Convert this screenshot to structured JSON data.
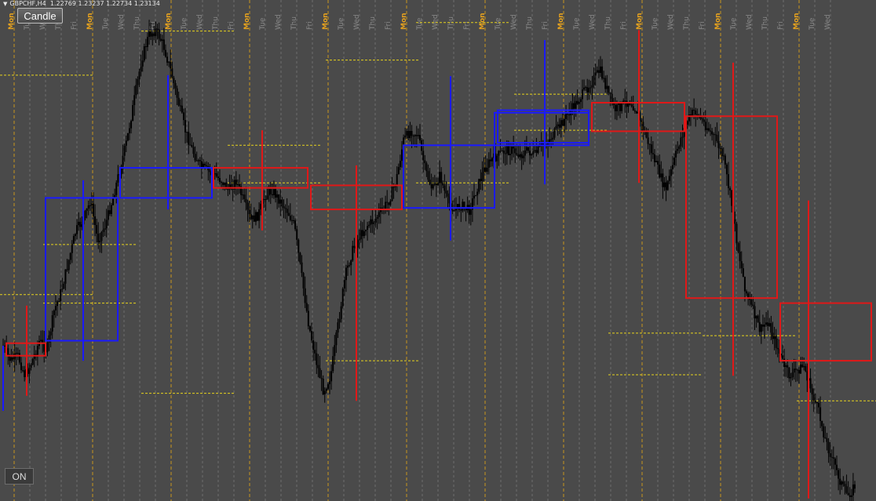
{
  "chart_header": {
    "symbol": "GBPCHF,H4",
    "ohlc": "1.22769 1.23237 1.22734 1.23134"
  },
  "buttons": {
    "mode_label": "Candle",
    "toggle_label": "ON"
  },
  "colors": {
    "background": "#4a4a4a",
    "candle": "#000000",
    "grid_weekday": "#6e6e6e",
    "grid_week": "#c8961e",
    "label_weekday": "#8a8a8a",
    "label_week": "#e6a21e",
    "bull_box": "#1a1aff",
    "bear_box": "#e01818",
    "level_line": "#e6d21e"
  },
  "chart_data": {
    "type": "candlestick",
    "symbol": "GBPCHF",
    "timeframe": "H4",
    "last_ohlc": {
      "open": 1.22769,
      "high": 1.23237,
      "low": 1.22734,
      "close": 1.23134
    },
    "x_day_labels": [
      "Mon",
      "Tue",
      "Wed",
      "Thu",
      "Fri",
      "Mon",
      "Tue",
      "Wed",
      "Thu",
      "Fri",
      "Mon",
      "Tue",
      "Wed",
      "Thu",
      "Fri",
      "Mon",
      "Tue",
      "Wed",
      "Thu",
      "Fri",
      "Mon",
      "Tue",
      "Wed",
      "Thu",
      "Fri",
      "Mon",
      "Tue",
      "Wed",
      "Thu",
      "Fri",
      "Mon",
      "Tue",
      "Wed",
      "Thu",
      "Fri",
      "Mon",
      "Tue",
      "Wed",
      "Thu",
      "Fri",
      "Mon",
      "Tue",
      "Wed",
      "Thu",
      "Fri",
      "Mon",
      "Tue",
      "Wed",
      "Thu",
      "Fri",
      "Mon",
      "Tue",
      "Wed"
    ],
    "price_path": [
      0.69,
      0.72,
      0.71,
      0.75,
      0.72,
      0.68,
      0.7,
      0.62,
      0.58,
      0.52,
      0.46,
      0.44,
      0.4,
      0.48,
      0.45,
      0.4,
      0.34,
      0.28,
      0.2,
      0.12,
      0.07,
      0.06,
      0.09,
      0.14,
      0.2,
      0.26,
      0.3,
      0.33,
      0.34,
      0.35,
      0.36,
      0.38,
      0.36,
      0.4,
      0.44,
      0.43,
      0.39,
      0.38,
      0.4,
      0.42,
      0.45,
      0.55,
      0.65,
      0.72,
      0.78,
      0.75,
      0.65,
      0.55,
      0.5,
      0.47,
      0.45,
      0.44,
      0.42,
      0.4,
      0.36,
      0.28,
      0.26,
      0.27,
      0.34,
      0.38,
      0.35,
      0.4,
      0.42,
      0.41,
      0.42,
      0.38,
      0.34,
      0.32,
      0.31,
      0.3,
      0.3,
      0.31,
      0.3,
      0.31,
      0.29,
      0.28,
      0.26,
      0.24,
      0.22,
      0.2,
      0.18,
      0.16,
      0.14,
      0.18,
      0.22,
      0.21,
      0.2,
      0.22,
      0.26,
      0.3,
      0.34,
      0.38,
      0.33,
      0.28,
      0.24,
      0.22,
      0.24,
      0.26,
      0.28,
      0.32,
      0.4,
      0.5,
      0.58,
      0.62,
      0.66,
      0.64,
      0.68,
      0.72,
      0.75,
      0.74,
      0.73,
      0.78,
      0.82,
      0.88,
      0.92,
      0.96,
      0.99,
      0.97
    ],
    "bull_boxes": [
      {
        "open": 0.68,
        "close": 0.395,
        "high": 0.36,
        "low": 0.72
      },
      {
        "open": 0.395,
        "close": 0.335,
        "high": 0.15,
        "low": 0.418
      },
      {
        "open": 0.415,
        "close": 0.29,
        "high": 0.152,
        "low": 0.48
      },
      {
        "open": 0.285,
        "close": 0.22,
        "high": 0.08,
        "low": 0.365
      },
      {
        "open": 0.29,
        "close": 0.225,
        "high": 0.09,
        "low": 0.368
      }
    ],
    "bear_boxes": [
      {
        "open": 0.685,
        "close": 0.71,
        "high": 0.61,
        "low": 0.79
      },
      {
        "open": 0.335,
        "close": 0.375,
        "high": 0.26,
        "low": 0.46
      },
      {
        "open": 0.37,
        "close": 0.418,
        "high": 0.33,
        "low": 0.8
      },
      {
        "open": 0.205,
        "close": 0.262,
        "high": 0.06,
        "low": 0.365
      },
      {
        "open": 0.232,
        "close": 0.595,
        "high": 0.125,
        "low": 0.75
      },
      {
        "open": 0.605,
        "close": 0.72,
        "high": 0.4,
        "low": 0.995
      }
    ],
    "levels": [
      {
        "value": 0.588
      },
      {
        "value": 0.605
      },
      {
        "value": 0.785
      },
      {
        "value": 0.29
      },
      {
        "value": 0.72
      },
      {
        "value": 0.045
      },
      {
        "value": 0.26
      },
      {
        "value": 0.665
      },
      {
        "value": 0.67
      },
      {
        "value": 0.8
      },
      {
        "value": 0.15
      },
      {
        "value": 0.488
      },
      {
        "value": 0.062
      },
      {
        "value": 0.365
      },
      {
        "value": 0.12
      },
      {
        "value": 0.365
      },
      {
        "value": 0.188
      },
      {
        "value": 0.748
      }
    ],
    "grid": true
  }
}
